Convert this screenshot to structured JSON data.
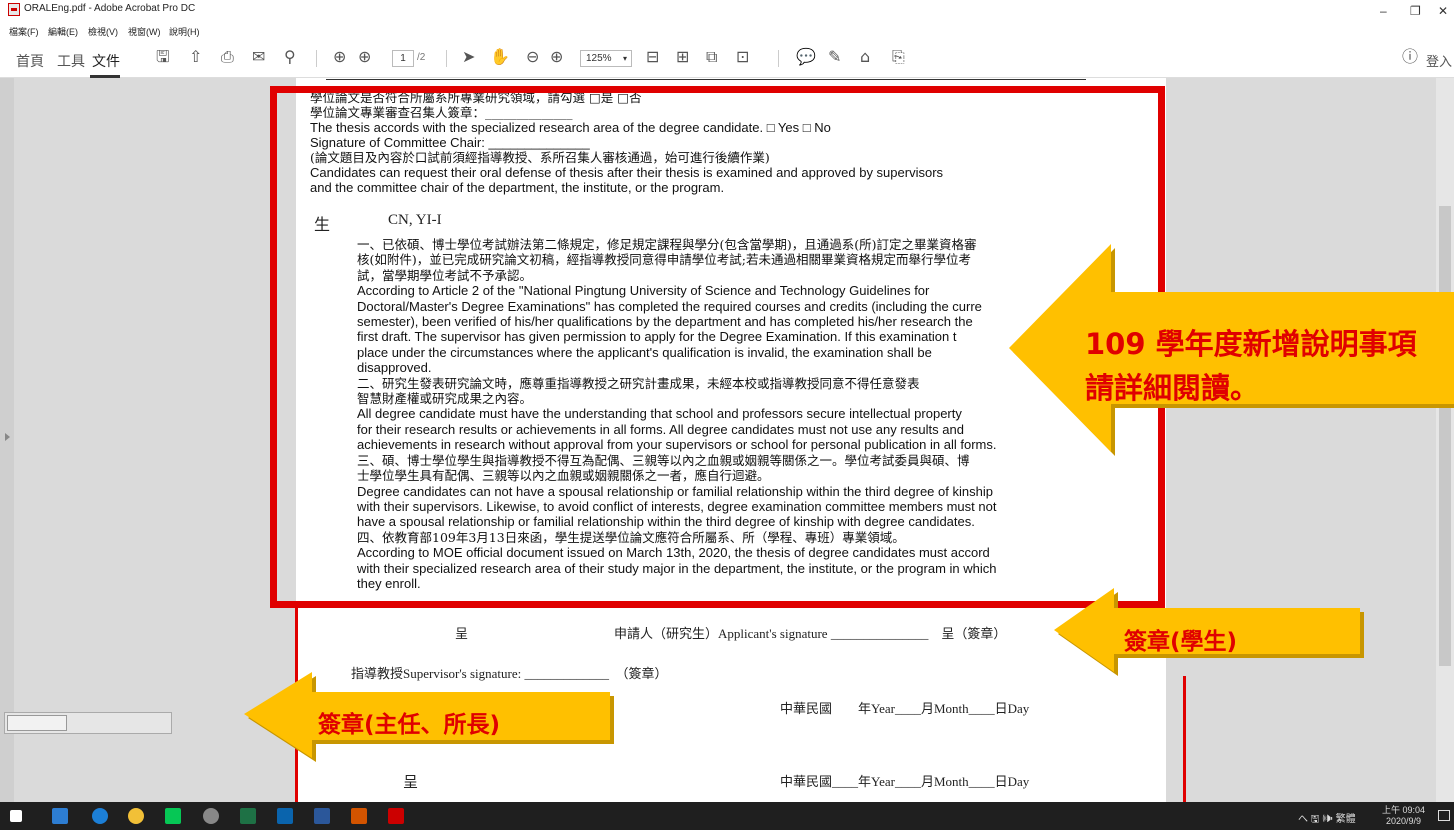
{
  "window": {
    "title": "ORALEng.pdf - Adobe Acrobat Pro DC",
    "minimize": "–",
    "restore": "❐",
    "close": "✕"
  },
  "menu": [
    "檔案(F)",
    "編輯(E)",
    "檢視(V)",
    "視窗(W)",
    "說明(H)"
  ],
  "toolbar": {
    "nav": [
      "首頁",
      "工具",
      "文件"
    ],
    "page_current": "1",
    "page_total": "/2",
    "zoom": "125%",
    "login": "登入"
  },
  "document": {
    "lines_top": [
      "學位論文是否符合所屬系所專業研究領域，請勾選 □是 □否",
      "學位論文專業審查召集人簽章：______________",
      "The thesis accords with the specialized research area of the degree candidate. □ Yes □ No",
      "Signature of Committee Chair: ______________",
      "(論文題目及內容於口試前須經指導教授、系所召集人審核通過，始可進行後續作業)",
      "Candidates can request their oral defense of thesis after their thesis is examined and approved by supervisors",
      "and the committee chair of the department, the institute, or the program."
    ],
    "sheng": "生",
    "name": "CN, YI-I",
    "items": [
      "一、已依碩、博士學位考試辦法第二條規定，修足規定課程與學分(包含當學期)，且通過系(所)訂定之畢業資格審",
      "核(如附件)，並已完成研究論文初稿，經指導教授同意得申請學位考試;若未通過相關畢業資格規定而舉行學位考",
      "試，當學期學位考試不予承認。",
      "According to Article 2 of the \"National Pingtung University of Science and Technology Guidelines for",
      "Doctoral/Master's Degree Examinations\"  has completed the required courses and credits (including the curre",
      "semester), been verified of his/her qualifications by the department and has completed his/her research the",
      "first draft. The supervisor has given permission to apply for the Degree Examination. If this examination t",
      "place under the circumstances where the applicant's qualification is invalid, the examination shall be",
      "disapproved.",
      "二、研究生發表研究論文時，應尊重指導教授之研究計畫成果，未經本校或指導教授同意不得任意發表",
      "智慧財產權或研究成果之內容。",
      "All degree candidate must have the understanding that school and professors secure intellectual property",
      "for their research results or achievements in all forms. All degree candidates must not use any results and",
      "achievements in research without approval from your supervisors or school for personal publication in all forms.",
      "三、碩、博士學位學生與指導教授不得互為配偶、三親等以內之血親或姻親等關係之一。學位考試委員與碩、博",
      "士學位學生具有配偶、三親等以內之血親或姻親關係之一者，應自行迴避。",
      "Degree candidates can not have a spousal relationship or familial relationship within the third degree of kinship",
      "with their supervisors. Likewise, to avoid conflict of interests, degree examination committee members must not",
      "have a spousal relationship or familial relationship within the third degree of kinship with degree candidates.",
      "四、依教育部109年3月13日來函，學生提送學位論文應符合所屬系、所（學程、專班）專業領域。",
      "According to MOE official document issued on March 13th, 2020, the thesis of degree candidates must accord",
      "with their specialized research area of their study major in the department, the institute, or the program in which",
      "they enroll."
    ],
    "cheng1": "呈",
    "applicant_sig": "申請人（研究生）Applicant's signature _______________　呈（簽章）",
    "supervisor_sig": "指導教授Supervisor's signature: _____________　（簽章）",
    "date1": "中華民國　　年Year____月Month____日Day",
    "cheng2": "呈",
    "date2": "中華民國____年Year____月Month____日Day"
  },
  "annotations": {
    "big": [
      "109 學年度新增說明事項",
      "請詳細閱讀。"
    ],
    "student": "簽章(學生)",
    "chair": "簽章(主任、所長)"
  },
  "colors": {
    "annotation_red": "#e00000",
    "arrow_yellow": "#ffc000",
    "arrow_border": "#c89600"
  },
  "taskbar": {
    "tray": "へ 🖫 🕪 繁體",
    "time": "上午 09:04",
    "date": "2020/9/9"
  }
}
